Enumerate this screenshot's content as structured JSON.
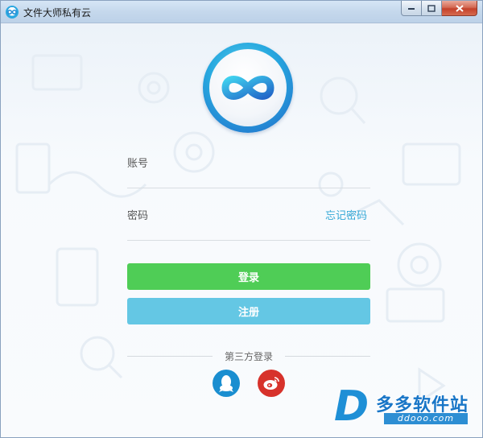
{
  "window": {
    "title": "文件大师私有云"
  },
  "form": {
    "account_label": "账号",
    "account_value": "",
    "password_label": "密码",
    "password_value": "",
    "forgot_password": "忘记密码",
    "login_button": "登录",
    "register_button": "注册",
    "third_party_label": "第三方登录"
  },
  "social": [
    {
      "name": "qq",
      "icon": "qq-penguin-icon",
      "color": "#1a8ed0"
    },
    {
      "name": "weibo",
      "icon": "weibo-icon",
      "color": "#d7322b"
    }
  ],
  "watermark": {
    "brand": "多多软件站",
    "url": "ddooo.com"
  },
  "colors": {
    "accent_green": "#4fcd56",
    "accent_blue": "#64c7e4",
    "link": "#34a8d6"
  }
}
